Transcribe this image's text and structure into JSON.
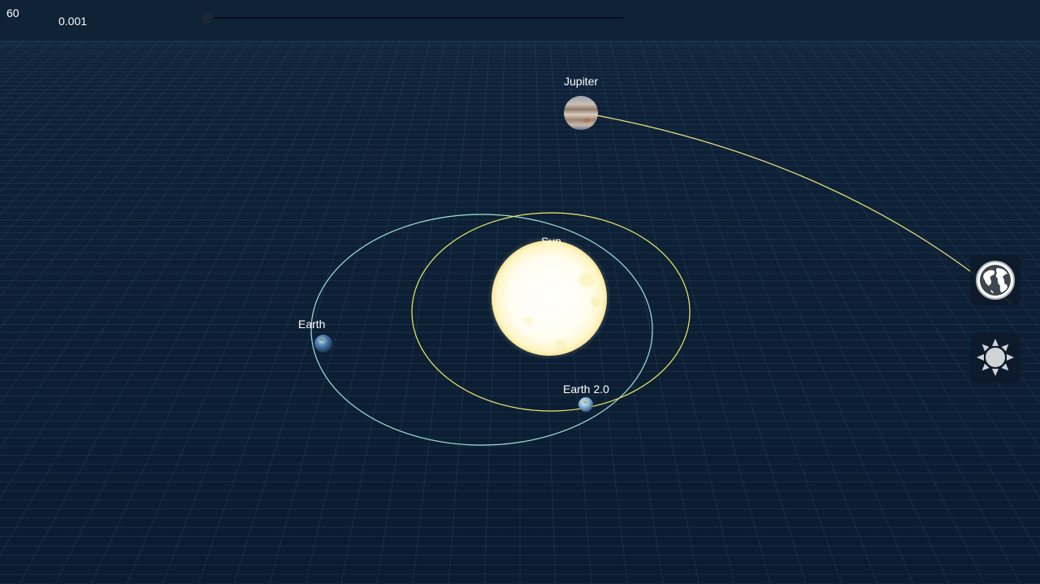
{
  "hud": {
    "fps": "60",
    "time_scale": "0.001",
    "time_scale_slider_fraction": 0.0
  },
  "bodies": [
    {
      "id": "jupiter",
      "label": "Jupiter"
    },
    {
      "id": "sun",
      "label": "Sun"
    },
    {
      "id": "earth",
      "label": "Earth"
    },
    {
      "id": "earth2",
      "label": "Earth 2.0"
    }
  ],
  "controls": {
    "globe_button_icon": "globe-icon",
    "sun_button_icon": "sun-icon"
  },
  "colors": {
    "background": "#0d1f33",
    "grid": "#2a4d72",
    "earth_orbit": "#9fe3d6",
    "earth2_orbit": "#e7ec6a",
    "jupiter_orbit": "#f2e680",
    "sun": "#fffbe6"
  }
}
